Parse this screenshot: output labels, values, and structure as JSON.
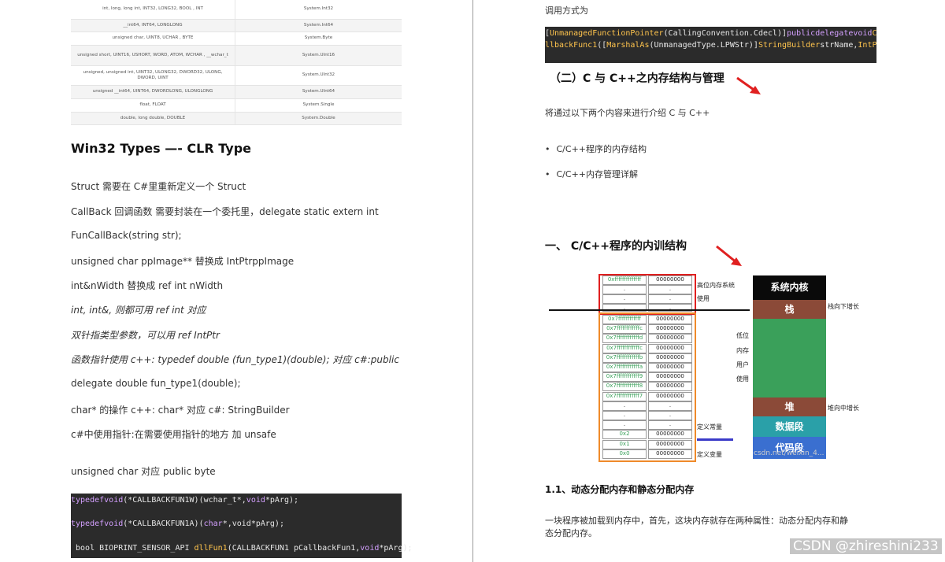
{
  "left": {
    "type_table": [
      [
        "int, long, long int, INT32, LONG32, BOOL , INT",
        "System.Int32"
      ],
      [
        "__int64, INT64, LONGLONG",
        "System.Int64"
      ],
      [
        "unsigned char, UINT8, UCHAR , BYTE",
        "System.Byte"
      ],
      [
        "unsigned short, UINT16, USHORT, WORD, ATOM, WCHAR , __wchar_t",
        "System.UInt16"
      ],
      [
        "unsigned, unsigned int, UINT32, ULONG32, DWORD32, ULONG, DWORD, UINT",
        "System.UInt32"
      ],
      [
        "unsigned __int64, UINT64, DWORDLONG, ULONGLONG",
        "System.UInt64"
      ],
      [
        "float, FLOAT",
        "System.Single"
      ],
      [
        "double, long double, DOUBLE",
        "System.Double"
      ]
    ],
    "heading": "Win32 Types —- CLR Type",
    "paragraphs": [
      "Struct 需要在 C#里重新定义一个 Struct",
      "CallBack 回调函数 需要封装在一个委托里，delegate static extern int",
      "FunCallBack(string str);",
      "unsigned char ppImage** 替换成 IntPtrppImage",
      "int&nWidth 替换成 ref int nWidth",
      "int, int&, 则都可用 ref int 对应",
      "双针指类型参数，可以用 ref IntPtr",
      "函数指针使用 c++: typedef double (fun_type1)(double); 对应 c#:public",
      "delegate double fun_type1(double);",
      "char* 的操作 c++: char* 对应 c#: StringBuilder",
      "c#中使用指针:在需要使用指针的地方 加 unsafe",
      "unsigned char 对应 public byte"
    ],
    "code_lines": [
      {
        "kw": "typedef",
        "t1": "void",
        "t2": "(*CALLBACKFUN1W)(wchar_t*,",
        "kw2": "void",
        "t3": "*pArg);"
      },
      {
        "kw": "typedef",
        "t1": "void",
        "t2": "(*CALLBACKFUN1A)(",
        "kw2": "char",
        "t3": "*,void*pArg);"
      },
      {
        "pre": " bool BIOPRINT_SENSOR_API ",
        "fn": "dllFun1",
        "rest": "(CALLBACKFUN1 pCallbackFun1,",
        "kw2": "void",
        "t3": "*pArg);"
      }
    ]
  },
  "right": {
    "call_label": "调用方式为",
    "code": {
      "l1a": "[",
      "l1b": "UnmanagedFunctionPointer",
      "l1c": "(CallingConvention.Cdecl)]",
      "l1d": "publicdelegatevoid",
      "l1e": "Ca",
      "l2a": "llbackFunc1",
      "l2b": "([",
      "l2c": "MarshalAs",
      "l2d": "(UnmanagedType.LPWStr)]",
      "l2e": "StringBuilder",
      "l2f": "strName,",
      "l2g": "IntPt"
    },
    "section2_title": "（二）C 与 C++之内存结构与管理",
    "intro": "将通过以下两个内容来进行介绍 C 与 C++",
    "bullets": [
      "C/C++程序的内存结构",
      "C/C++内存管理详解"
    ],
    "section1_title": "一、 C/C++程序的内训结构",
    "diagram": {
      "top_addresses": [
        [
          "0xffffffffffffff",
          "00000000"
        ],
        [
          ".",
          "."
        ],
        [
          ".",
          "."
        ],
        [
          ".",
          "."
        ]
      ],
      "user_addresses": [
        [
          "0x7ffffffffffff",
          "00000000"
        ],
        [
          "0x7ffffffffffffc",
          "00000000"
        ],
        [
          "0x7ffffffffffffd",
          "00000000"
        ],
        [
          "0x7ffffffffffffc",
          "00000000"
        ],
        [
          "0x7ffffffffffffb",
          "00000000"
        ],
        [
          "0x7ffffffffffffa",
          "00000000"
        ],
        [
          "0x7ffffffffffff9",
          "00000000"
        ],
        [
          "0x7ffffffffffff8",
          "00000000"
        ],
        [
          "0x7ffffffffffff7",
          "00000000"
        ],
        [
          ".",
          "."
        ],
        [
          ".",
          "."
        ],
        [
          ".",
          "."
        ],
        [
          "0x2",
          "00000000"
        ],
        [
          "0x1",
          "00000000"
        ],
        [
          "0x0",
          "00000000"
        ]
      ],
      "label_high": "高位内存系统",
      "label_high2": "使用",
      "label_low": [
        "低位",
        "内存",
        "用户",
        "使用"
      ],
      "label_const": "定义常量",
      "label_var": "定义变量",
      "blocks": [
        "系统内核",
        "栈",
        "堆",
        "数据段",
        "代码段"
      ],
      "stack_note": "栈向下增长",
      "heap_note": "堆向中增长",
      "watermark": "csdn.net/weixin_4..."
    },
    "sub_title": "1.1、动态分配内存和静态分配内存",
    "para": [
      "一块程序被加载到内存中，首先，这块内存就存在两种属性：动态分配内存和静",
      "态分配内存。"
    ],
    "footer_watermark": "CSDN @zhireshini233"
  },
  "colors": {
    "red": "#e02020",
    "orange": "#ef8a2a",
    "black_block": "#0a0a0a",
    "brown": "#8b4a38",
    "green": "#3aa05a",
    "teal": "#2aa0a8",
    "blue": "#3a6fd0"
  }
}
